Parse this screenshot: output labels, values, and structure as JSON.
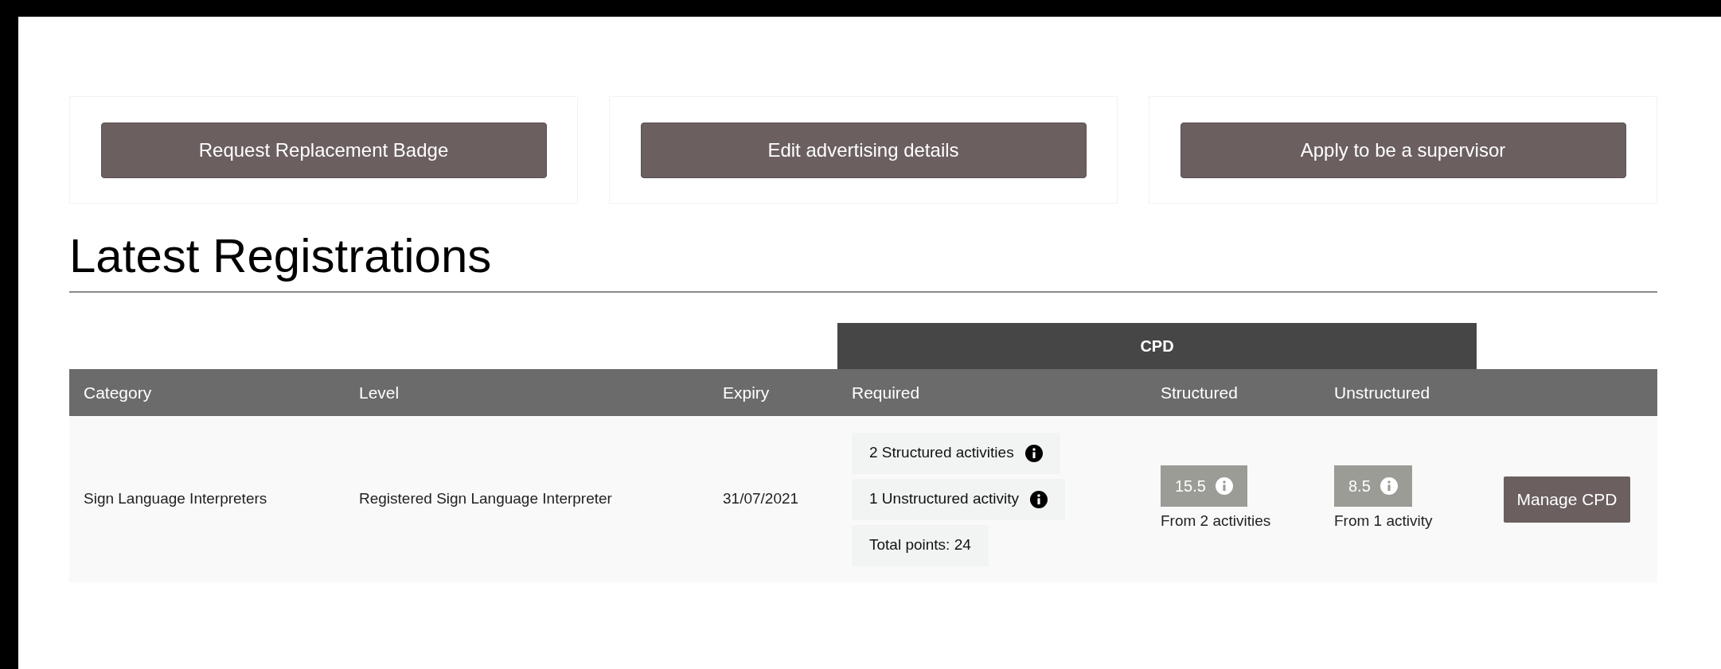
{
  "action_buttons": [
    "Request Replacement Badge",
    "Edit advertising details",
    "Apply to be a supervisor"
  ],
  "heading": "Latest Registrations",
  "table": {
    "group_header": "CPD",
    "columns": [
      "Category",
      "Level",
      "Expiry",
      "Required",
      "Structured",
      "Unstructured"
    ],
    "rows": [
      {
        "category": "Sign Language Interpreters",
        "level": "Registered Sign Language Interpreter",
        "expiry": "31/07/2021",
        "required": [
          {
            "text": "2 Structured activities",
            "info": true
          },
          {
            "text": "1 Unstructured activity",
            "info": true
          },
          {
            "text": "Total points: 24",
            "info": false
          }
        ],
        "structured": {
          "points": "15.5",
          "note": "From 2 activities"
        },
        "unstructured": {
          "points": "8.5",
          "note": "From 1 activity"
        },
        "action": "Manage CPD"
      }
    ]
  }
}
